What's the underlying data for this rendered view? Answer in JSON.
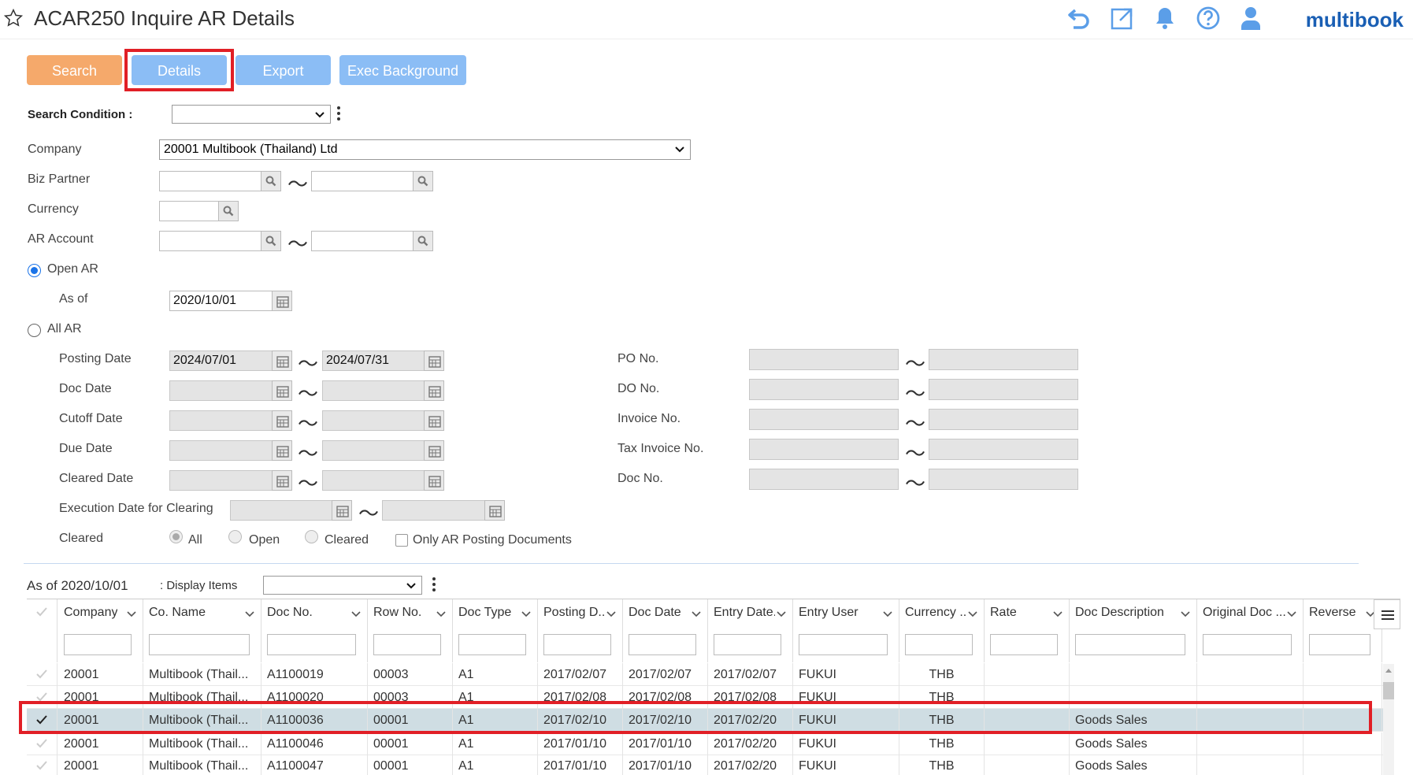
{
  "header": {
    "title": "ACAR250 Inquire AR Details",
    "logo": "multibook",
    "icons": [
      "star-icon",
      "back-icon",
      "popout-icon",
      "bell-icon",
      "help-icon",
      "user-icon"
    ]
  },
  "toolbar": {
    "search_label": "Search",
    "details_label": "Details",
    "export_label": "Export",
    "exec_label": "Exec Background"
  },
  "colors": {
    "orange": "#f5a96b",
    "blue": "#8bbdf5",
    "highlight": "#e11f26",
    "selected_row": "#cfdde3",
    "brand": "#1a5fb4"
  },
  "form": {
    "search_condition_label": "Search Condition :",
    "search_condition_value": "",
    "company_label": "Company",
    "company_value": "20001 Multibook (Thailand) Ltd",
    "biz_partner_label": "Biz Partner",
    "currency_label": "Currency",
    "ar_account_label": "AR Account",
    "open_ar_label": "Open AR",
    "as_of_label": "As of",
    "as_of_value": "2020/10/01",
    "all_ar_label": "All AR",
    "posting_date_label": "Posting Date",
    "posting_date_from": "2024/07/01",
    "posting_date_to": "2024/07/31",
    "doc_date_label": "Doc Date",
    "cutoff_date_label": "Cutoff Date",
    "due_date_label": "Due Date",
    "cleared_date_label": "Cleared Date",
    "exec_date_label": "Execution Date for Clearing",
    "cleared_label": "Cleared",
    "cleared_all": "All",
    "cleared_open": "Open",
    "cleared_cleared": "Cleared",
    "only_ar_label": "Only AR Posting Documents",
    "po_no_label": "PO No.",
    "do_no_label": "DO No.",
    "invoice_no_label": "Invoice No.",
    "tax_invoice_no_label": "Tax Invoice No.",
    "doc_no_label": "Doc No.",
    "tilde": "〜"
  },
  "grid": {
    "as_of_text": "As of 2020/10/01",
    "display_items_label": ": Display Items",
    "columns": [
      "Company",
      "Co. Name",
      "Doc No.",
      "Row No.",
      "Doc Type",
      "Posting D...",
      "Doc Date",
      "Entry Date...",
      "Entry User",
      "Currency ...",
      "Rate",
      "Doc Description",
      "Original Doc ...",
      "Reverse"
    ],
    "rows": [
      [
        "20001",
        "Multibook (Thail...",
        "A1100019",
        "00003",
        "A1",
        "2017/02/07",
        "2017/02/07",
        "2017/02/07",
        "FUKUI",
        "THB",
        "",
        "",
        "",
        ""
      ],
      [
        "20001",
        "Multibook (Thail...",
        "A1100020",
        "00003",
        "A1",
        "2017/02/08",
        "2017/02/08",
        "2017/02/08",
        "FUKUI",
        "THB",
        "",
        "",
        "",
        ""
      ],
      [
        "20001",
        "Multibook (Thail...",
        "A1100036",
        "00001",
        "A1",
        "2017/02/10",
        "2017/02/10",
        "2017/02/20",
        "FUKUI",
        "THB",
        "",
        "Goods Sales",
        "",
        ""
      ],
      [
        "20001",
        "Multibook (Thail...",
        "A1100046",
        "00001",
        "A1",
        "2017/01/10",
        "2017/01/10",
        "2017/02/20",
        "FUKUI",
        "THB",
        "",
        "Goods Sales",
        "",
        ""
      ],
      [
        "20001",
        "Multibook (Thail...",
        "A1100047",
        "00001",
        "A1",
        "2017/01/10",
        "2017/01/10",
        "2017/02/20",
        "FUKUI",
        "THB",
        "",
        "Goods Sales",
        "",
        ""
      ]
    ]
  }
}
